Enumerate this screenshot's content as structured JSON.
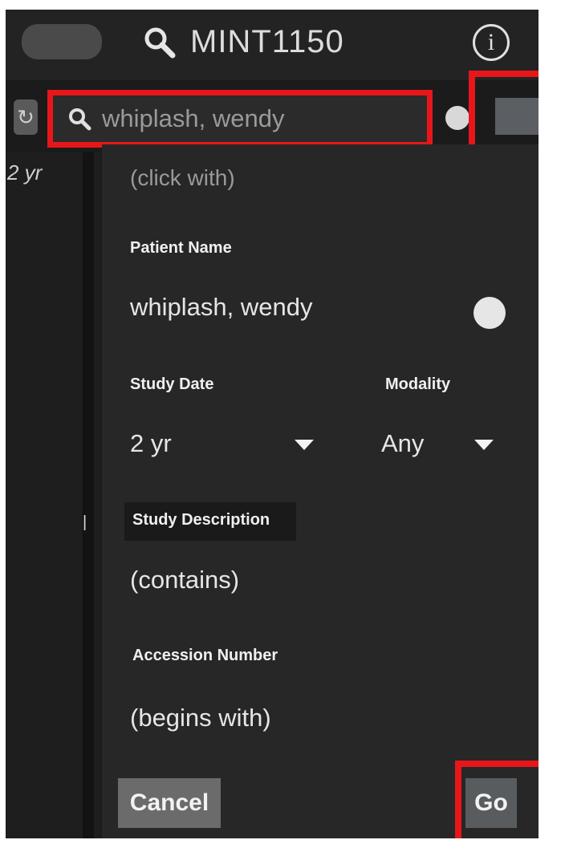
{
  "header": {
    "title": "MINT1150"
  },
  "search": {
    "value": "whiplash, wendy"
  },
  "sidebar": {
    "age_label": "2 yr"
  },
  "form": {
    "clipped_hint": "(click with)",
    "patient_name": {
      "label": "Patient Name",
      "value": "whiplash, wendy"
    },
    "study_date": {
      "label": "Study Date",
      "value": "2 yr"
    },
    "modality": {
      "label": "Modality",
      "value": "Any"
    },
    "study_description": {
      "label": "Study Description",
      "placeholder": "(contains)"
    },
    "accession_number": {
      "label": "Accession Number",
      "placeholder": "(begins with)"
    }
  },
  "buttons": {
    "cancel": "Cancel",
    "go": "Go"
  },
  "colors": {
    "highlight": "#e8161b",
    "background": "#1b1b1b",
    "panel": "#272727"
  },
  "icons": [
    "search-icon",
    "info-icon",
    "refresh-icon",
    "dropdown-caret-icon",
    "clear-icon"
  ]
}
